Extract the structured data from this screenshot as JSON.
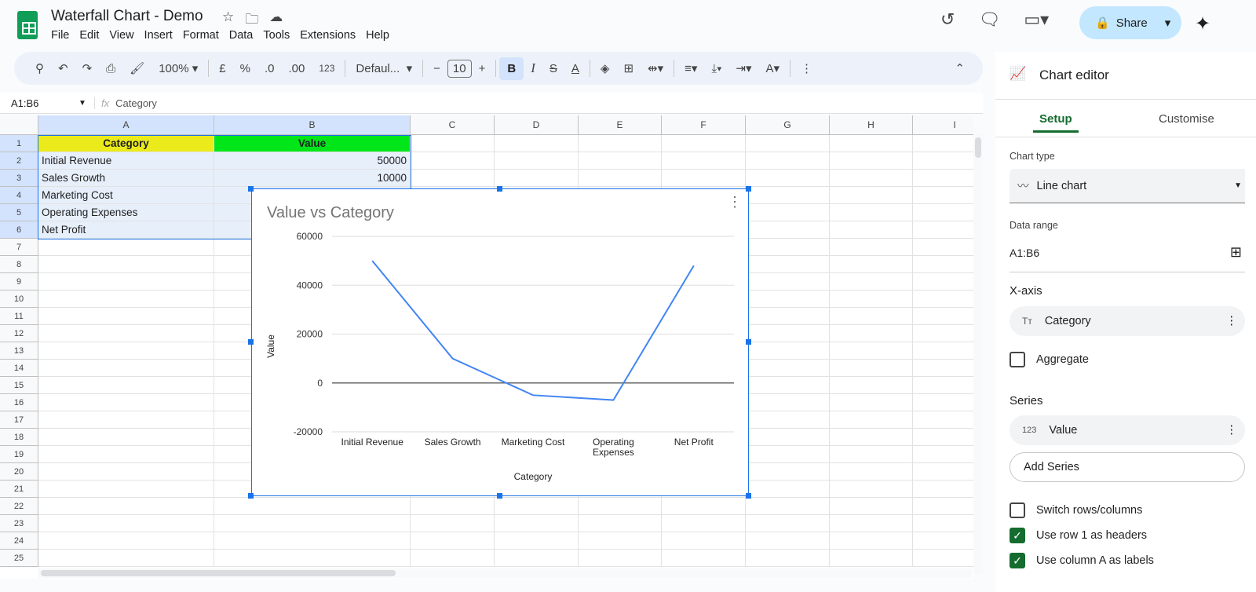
{
  "app": {
    "title": "Waterfall Chart - Demo",
    "menu": [
      "File",
      "Edit",
      "View",
      "Insert",
      "Format",
      "Data",
      "Tools",
      "Extensions",
      "Help"
    ],
    "share": "Share"
  },
  "toolbar": {
    "zoom": "100%",
    "currency": "£",
    "percent": "%",
    "dec_less": ".0",
    "dec_more": ".00",
    "number_format": "123",
    "font": "Defaul...",
    "font_size": "10",
    "bold": "B",
    "italic": "I"
  },
  "formula_bar": {
    "name_box": "A1:B6",
    "fx": "fx",
    "content": "Category"
  },
  "columns": [
    "A",
    "B",
    "C",
    "D",
    "E",
    "F",
    "G",
    "H",
    "I"
  ],
  "rows": [
    "1",
    "2",
    "3",
    "4",
    "5",
    "6",
    "7",
    "8",
    "9",
    "10",
    "11",
    "12",
    "13",
    "14",
    "15",
    "16",
    "17",
    "18",
    "19",
    "20",
    "21",
    "22",
    "23",
    "24",
    "25"
  ],
  "cells": {
    "a": [
      "Category",
      "Initial Revenue",
      "Sales Growth",
      "Marketing Cost",
      "Operating Expenses",
      "Net Profit"
    ],
    "b": [
      "Value",
      "50000",
      "10000"
    ]
  },
  "chart_data": {
    "type": "line",
    "title": "Value vs Category",
    "xlabel": "Category",
    "ylabel": "Value",
    "categories": [
      "Initial Revenue",
      "Sales Growth",
      "Marketing Cost",
      "Operating Expenses",
      "Net Profit"
    ],
    "values": [
      50000,
      10000,
      -5000,
      -7000,
      48000
    ],
    "ylim": [
      -20000,
      60000
    ],
    "yticks": [
      "60000",
      "40000",
      "20000",
      "0",
      "-20000"
    ],
    "color": "#4285f4",
    "grid": true
  },
  "editor": {
    "title": "Chart editor",
    "tabs": [
      "Setup",
      "Customise"
    ],
    "chart_type_label": "Chart type",
    "chart_type": "Line chart",
    "data_range_label": "Data range",
    "data_range": "A1:B6",
    "xaxis_label": "X-axis",
    "xaxis_value": "Category",
    "aggregate": "Aggregate",
    "series_label": "Series",
    "series_value": "Value",
    "series_icon": "123",
    "add_series": "Add Series",
    "switch": "Switch rows/columns",
    "row1": "Use row 1 as headers",
    "colA": "Use column A as labels"
  }
}
